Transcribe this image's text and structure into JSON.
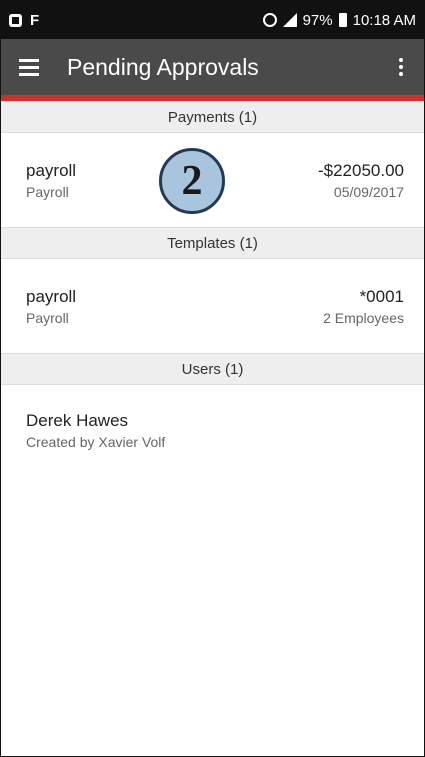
{
  "status_bar": {
    "battery": "97%",
    "time": "10:18 AM"
  },
  "app_bar": {
    "title": "Pending Approvals"
  },
  "sections": {
    "payments": {
      "header": "Payments (1)",
      "item": {
        "name": "payroll",
        "type": "Payroll",
        "amount": "-$22050.00",
        "date": "05/09/2017"
      }
    },
    "templates": {
      "header": "Templates (1)",
      "item": {
        "name": "payroll",
        "type": "Payroll",
        "code": "*0001",
        "employees": "2 Employees"
      }
    },
    "users": {
      "header": "Users (1)",
      "item": {
        "name": "Derek Hawes",
        "created_by": "Created by Xavier Volf"
      }
    }
  },
  "overlay": {
    "step_number": "2"
  }
}
